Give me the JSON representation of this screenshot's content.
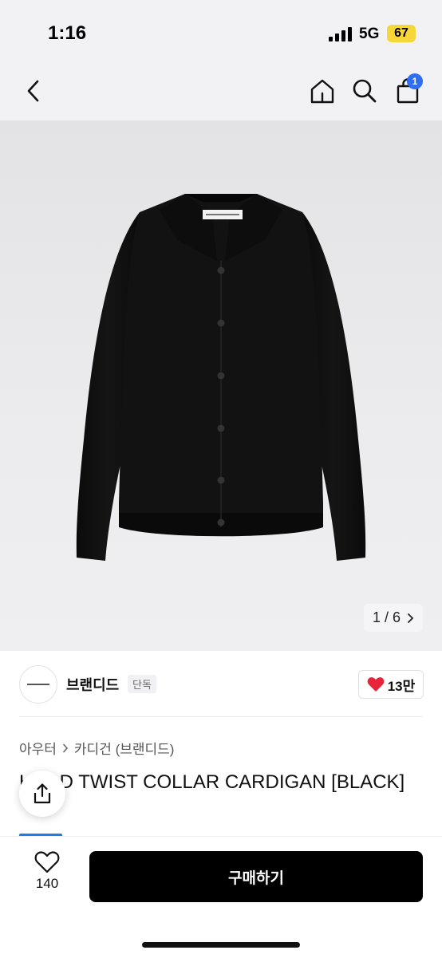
{
  "status_bar": {
    "time": "1:16",
    "network": "5G",
    "battery": "67"
  },
  "nav": {
    "back_icon": "chevron-left-icon",
    "home_icon": "home-icon",
    "search_icon": "search-icon",
    "cart_icon": "shopping-bag-icon",
    "cart_count": "1"
  },
  "image": {
    "counter": "1 / 6",
    "label_text": "BRANDED INDUSTRY"
  },
  "brand": {
    "name": "브랜디드",
    "badge": "단독",
    "likes": "13만"
  },
  "breadcrumb": {
    "parent": "아우터",
    "child": "카디건 (브랜디드)"
  },
  "product": {
    "title": "HARD TWIST COLLAR CARDIGAN [BLACK]"
  },
  "bottom": {
    "wish_count": "140",
    "buy_label": "구매하기"
  },
  "colors": {
    "accent_blue": "#2f6ef2",
    "heart_red": "#e8243b",
    "tag_blue": "#1f7ce6"
  }
}
